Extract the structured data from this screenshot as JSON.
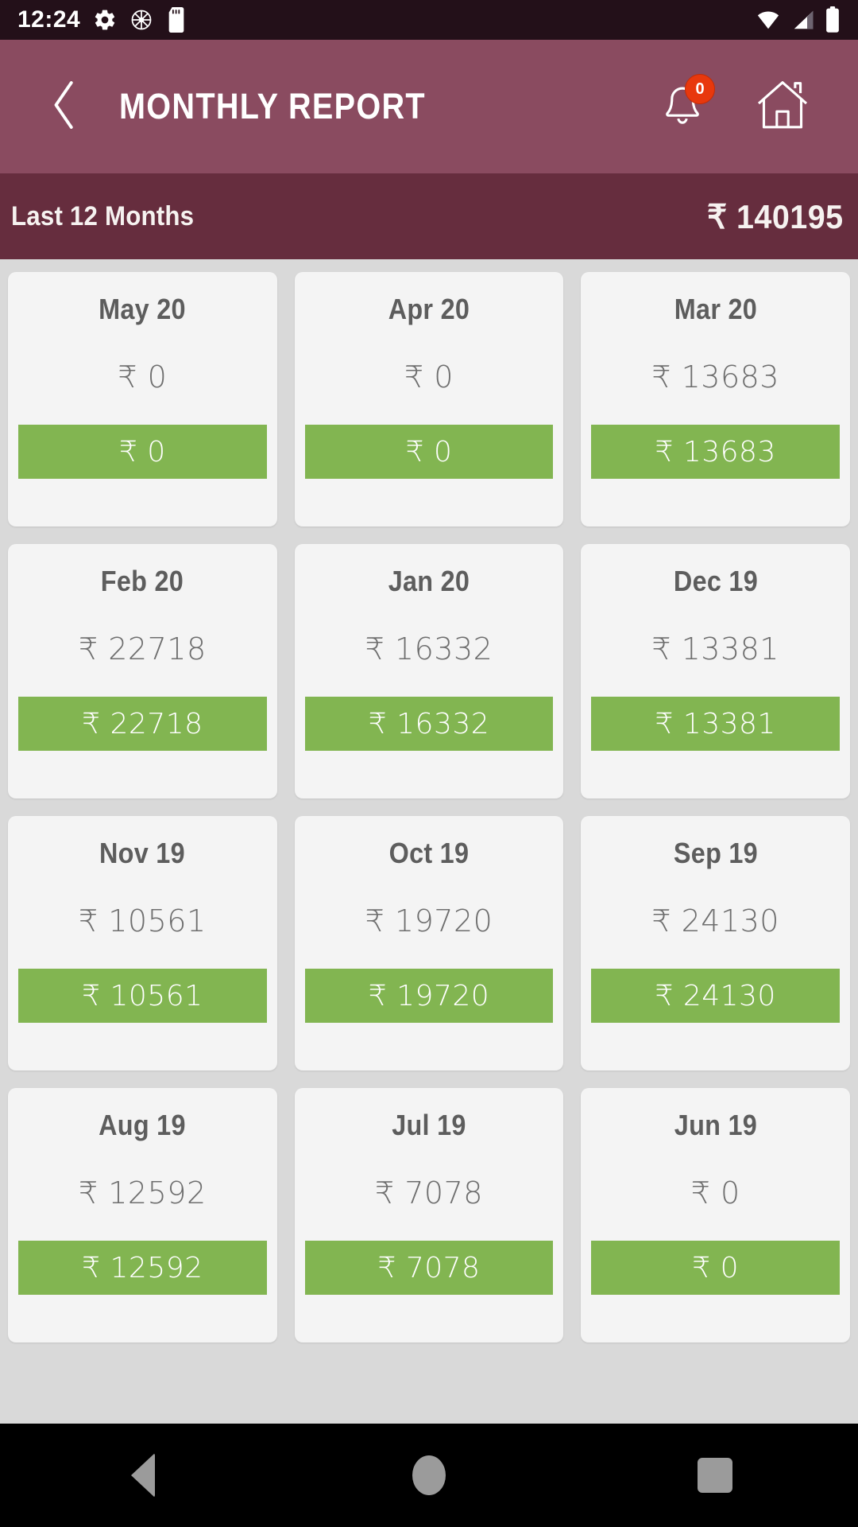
{
  "status_bar": {
    "time": "12:24",
    "left_icons": [
      "gear-icon",
      "ship-wheel-icon",
      "sd-card-icon"
    ],
    "right_icons": [
      "wifi-icon",
      "cellular-signal-icon",
      "battery-icon"
    ],
    "background": "#231019"
  },
  "app_bar": {
    "title": "MONTHLY REPORT",
    "back_icon": "chevron-left-icon",
    "notification_icon": "bell-icon",
    "notification_badge": "0",
    "home_icon": "home-icon",
    "background": "#8a4b60",
    "badge_color": "#e8380d"
  },
  "sub_header": {
    "label": "Last 12 Months",
    "total": "₹ 140195",
    "background": "#662d3e"
  },
  "theme": {
    "page_background": "#d9d9d9",
    "card_background": "#f4f4f4",
    "bar_green": "#82b551",
    "month_text": "#5d5d5d",
    "amount_text": "#6e6e6e"
  },
  "months": [
    {
      "month": "May 20",
      "amount": "₹ 0",
      "bar_amount": "₹ 0",
      "value": 0
    },
    {
      "month": "Apr 20",
      "amount": "₹ 0",
      "bar_amount": "₹ 0",
      "value": 0
    },
    {
      "month": "Mar 20",
      "amount": "₹ 13683",
      "bar_amount": "₹ 13683",
      "value": 13683
    },
    {
      "month": "Feb 20",
      "amount": "₹ 22718",
      "bar_amount": "₹ 22718",
      "value": 22718
    },
    {
      "month": "Jan 20",
      "amount": "₹ 16332",
      "bar_amount": "₹ 16332",
      "value": 16332
    },
    {
      "month": "Dec 19",
      "amount": "₹ 13381",
      "bar_amount": "₹ 13381",
      "value": 13381
    },
    {
      "month": "Nov 19",
      "amount": "₹ 10561",
      "bar_amount": "₹ 10561",
      "value": 10561
    },
    {
      "month": "Oct 19",
      "amount": "₹ 19720",
      "bar_amount": "₹ 19720",
      "value": 19720
    },
    {
      "month": "Sep 19",
      "amount": "₹ 24130",
      "bar_amount": "₹ 24130",
      "value": 24130
    },
    {
      "month": "Aug 19",
      "amount": "₹ 12592",
      "bar_amount": "₹ 12592",
      "value": 12592
    },
    {
      "month": "Jul 19",
      "amount": "₹ 7078",
      "bar_amount": "₹ 7078",
      "value": 7078
    },
    {
      "month": "Jun 19",
      "amount": "₹ 0",
      "bar_amount": "₹ 0",
      "value": 0
    }
  ],
  "nav_bar": {
    "back_label": "back-triangle-icon",
    "home_label": "home-circle-icon",
    "recents_label": "recents-square-icon"
  }
}
